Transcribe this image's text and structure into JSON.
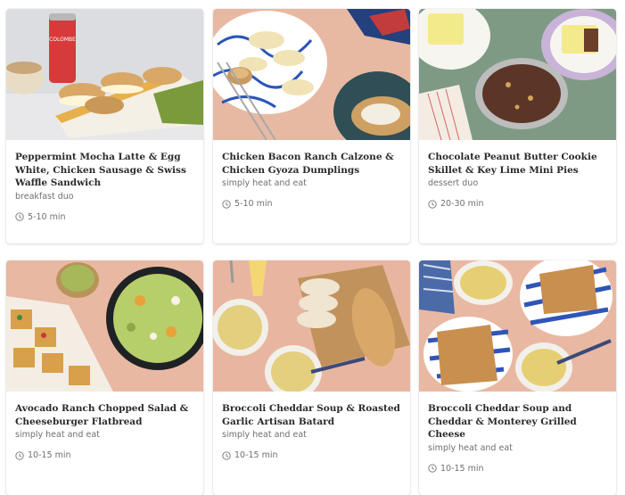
{
  "cards": [
    {
      "title": "Peppermint Mocha Latte & Egg White, Chicken Sausage & Swiss Waffle Sandwich",
      "subtitle": "breakfast duo",
      "time": "5-10 min",
      "can_text": "COLOMBE"
    },
    {
      "title": "Chicken Bacon Ranch Calzone & Chicken Gyoza Dumplings",
      "subtitle": "simply heat and eat",
      "time": "5-10 min"
    },
    {
      "title": "Chocolate Peanut Butter Cookie Skillet & Key Lime Mini Pies",
      "subtitle": "dessert duo",
      "time": "20-30 min"
    },
    {
      "title": "Avocado Ranch Chopped Salad & Cheeseburger Flatbread",
      "subtitle": "simply heat and eat",
      "time": "10-15 min"
    },
    {
      "title": "Broccoli Cheddar Soup & Roasted Garlic Artisan Batard",
      "subtitle": "simply heat and eat",
      "time": "10-15 min"
    },
    {
      "title": "Broccoli Cheddar Soup and Cheddar & Monterey Grilled Cheese",
      "subtitle": "simply heat and eat",
      "time": "10-15 min"
    }
  ],
  "icons": {
    "time": "clock-icon"
  }
}
